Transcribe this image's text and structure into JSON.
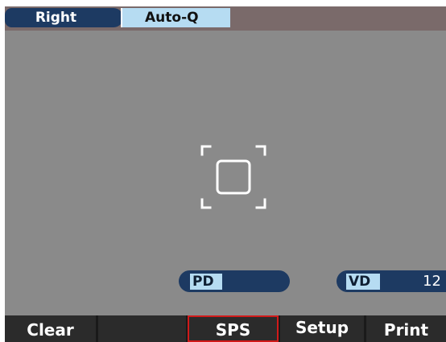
{
  "header": {
    "eye_label": "Right",
    "mode_label": "Auto-Q"
  },
  "measurements": {
    "pd": {
      "label": "PD",
      "value": ""
    },
    "vd": {
      "label": "VD",
      "value": "12"
    }
  },
  "function_bar": {
    "buttons": [
      {
        "label": "Clear"
      },
      {
        "label": ""
      },
      {
        "label": "SPS",
        "selected": true
      },
      {
        "label": "Setup"
      },
      {
        "label": "Print"
      }
    ]
  },
  "colors": {
    "screen_background": "#8a8a8a",
    "label_navy": "#1d3a62",
    "label_light_blue": "#b6dcf2",
    "selected_outline": "#d11a1a",
    "function_bar": "#2b2b2b"
  },
  "icons": {
    "reticle": "focus-reticle-icon"
  }
}
